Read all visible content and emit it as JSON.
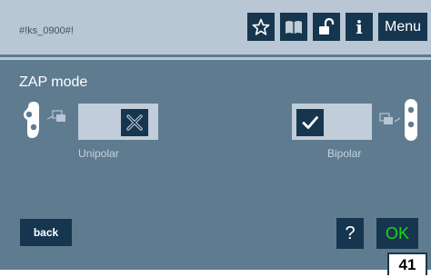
{
  "header": {
    "code": "#!ks_0900#!",
    "menu_label": "Menu",
    "info_label": "i",
    "icons": [
      "star-icon",
      "book-icon",
      "unlock-icon",
      "info-icon"
    ]
  },
  "main": {
    "title": "ZAP mode",
    "options": [
      {
        "label": "Unipolar",
        "selected": false
      },
      {
        "label": "Bipolar",
        "selected": true
      }
    ]
  },
  "footer": {
    "back_label": "back",
    "help_label": "?",
    "ok_label": "OK",
    "page_number": "41"
  },
  "colors": {
    "background": "#5f7b90",
    "header": "#b9c6d4",
    "button": "#16364f",
    "ok_text": "#1cd41c"
  }
}
